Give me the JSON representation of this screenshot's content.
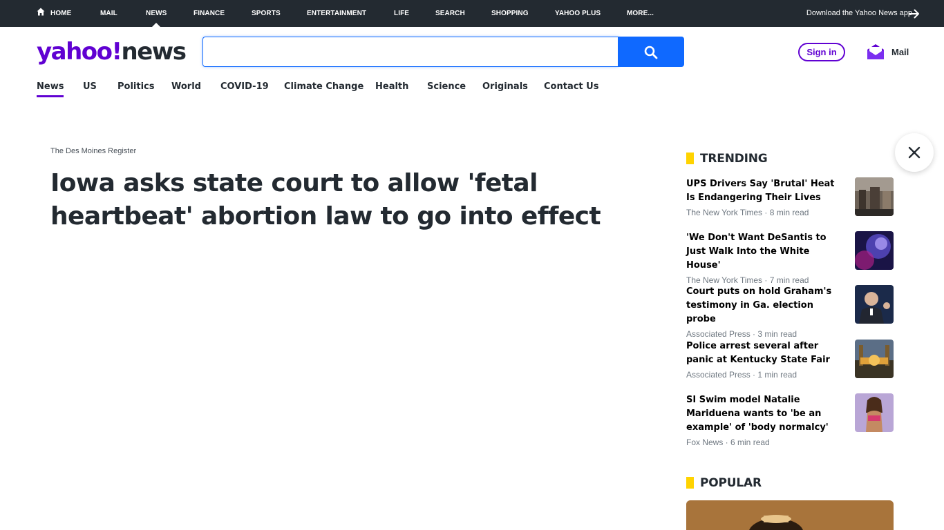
{
  "topnav": {
    "items": [
      "HOME",
      "MAIL",
      "NEWS",
      "FINANCE",
      "SPORTS",
      "ENTERTAINMENT",
      "LIFE",
      "SEARCH",
      "SHOPPING",
      "YAHOO PLUS",
      "MORE..."
    ],
    "active": "NEWS",
    "download_app": "Download the Yahoo News app"
  },
  "header": {
    "logo_yahoo": "yahoo",
    "logo_exclaim": "!",
    "logo_news": "news",
    "search": {
      "value": "",
      "placeholder": ""
    },
    "signin": "Sign in",
    "mail": "Mail"
  },
  "subnav": {
    "tabs": [
      "News",
      "US",
      "Politics",
      "World",
      "COVID-19",
      "Climate Change",
      "Health",
      "Science",
      "Originals",
      "Contact Us"
    ],
    "active": "News"
  },
  "article": {
    "source": "The Des Moines Register",
    "headline": "Iowa asks state court to allow 'fetal heartbeat' abortion law to go into effect"
  },
  "sidebar": {
    "trending_title": "TRENDING",
    "trending": [
      {
        "title": "UPS Drivers Say 'Brutal' Heat Is Endangering Their Lives",
        "source": "The New York Times",
        "read": "8 min read"
      },
      {
        "title": "'We Don't Want DeSantis to Just Walk Into the White House'",
        "source": "The New York Times",
        "read": "7 min read"
      },
      {
        "title": "Court puts on hold Graham's testimony in Ga. election probe",
        "source": "Associated Press",
        "read": "3 min read"
      },
      {
        "title": "Police arrest several after panic at Kentucky State Fair",
        "source": "Associated Press",
        "read": "1 min read"
      },
      {
        "title": "SI Swim model Natalie Mariduena wants to 'be an example' of 'body normalcy'",
        "source": "Fox News",
        "read": "6 min read"
      }
    ],
    "popular_title": "POPULAR"
  },
  "colors": {
    "brand": "#6001d2",
    "search_blue": "#0f69ff",
    "topbar": "#232a31",
    "accent_yellow": "#ffd300"
  }
}
